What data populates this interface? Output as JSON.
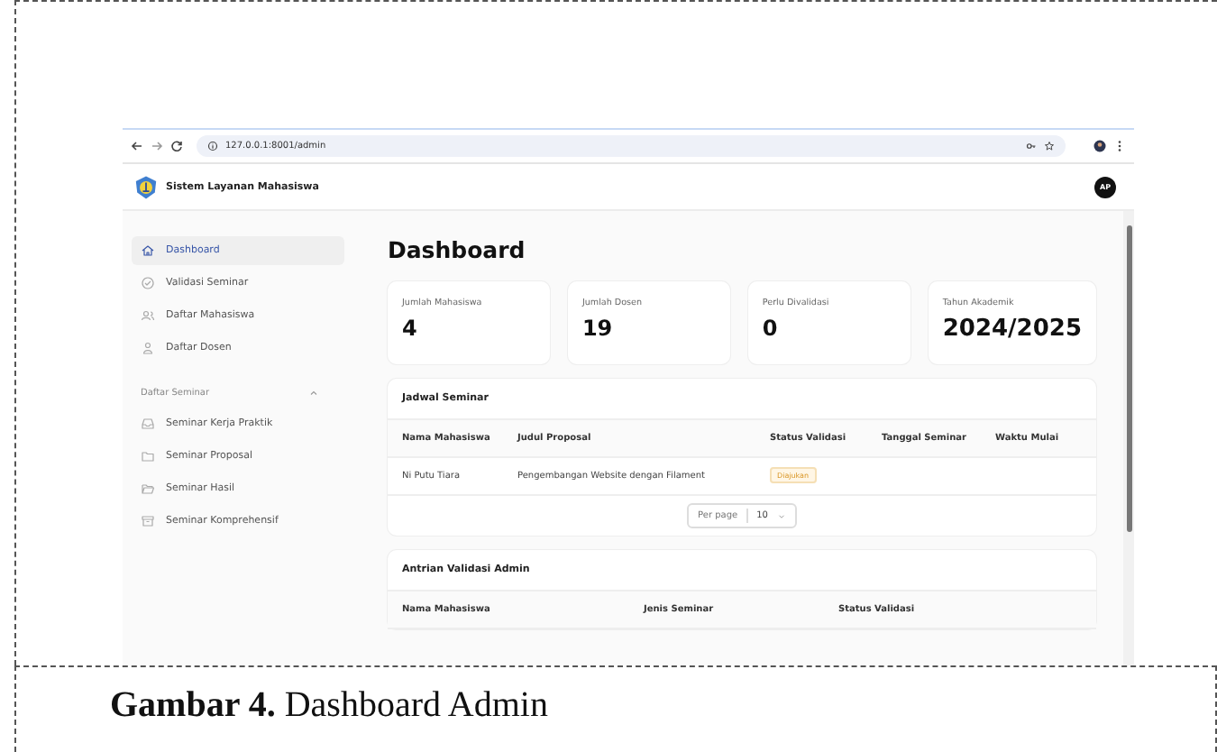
{
  "browser": {
    "url": "127.0.0.1:8001/admin"
  },
  "app": {
    "title": "Sistem Layanan Mahasiswa",
    "avatar": "AP"
  },
  "sidebar": {
    "items": [
      {
        "label": "Dashboard",
        "selected": true
      },
      {
        "label": "Validasi Seminar",
        "selected": false
      },
      {
        "label": "Daftar Mahasiswa",
        "selected": false
      },
      {
        "label": "Daftar Dosen",
        "selected": false
      }
    ],
    "group": {
      "label": "Daftar Seminar",
      "expanded": true,
      "items": [
        {
          "label": "Seminar Kerja Praktik",
          "selected": false
        },
        {
          "label": "Seminar Proposal",
          "selected": false
        },
        {
          "label": "Seminar Hasil",
          "selected": false
        },
        {
          "label": "Seminar Komprehensif",
          "selected": false
        }
      ]
    }
  },
  "page_title": "Dashboard",
  "stats": [
    {
      "label": "Jumlah Mahasiswa",
      "value": "4"
    },
    {
      "label": "Jumlah Dosen",
      "value": "19"
    },
    {
      "label": "Perlu Divalidasi",
      "value": "0"
    },
    {
      "label": "Tahun Akademik",
      "value": "2024/2025"
    }
  ],
  "schedule": {
    "title": "Jadwal Seminar",
    "columns": [
      "Nama Mahasiswa",
      "Judul Proposal",
      "Status Validasi",
      "Tanggal Seminar",
      "Waktu Mulai"
    ],
    "rows": [
      {
        "name": "Ni Putu Tiara",
        "title": "Pengembangan Website dengan Filament",
        "status": "Diajukan"
      }
    ],
    "pagination": {
      "label": "Per page",
      "value": "10"
    }
  },
  "queue": {
    "title": "Antrian Validasi Admin",
    "columns": [
      "Nama Mahasiswa",
      "Jenis Seminar",
      "Status Validasi"
    ]
  },
  "caption": "**Gambar 4.** Dashboard Admin"
}
